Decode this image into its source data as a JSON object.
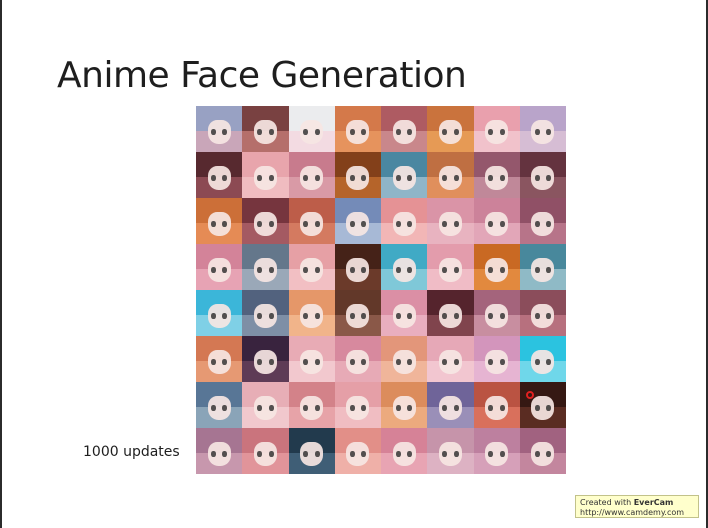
{
  "slide": {
    "title": "Anime Face Generation",
    "caption": "1000 updates"
  },
  "watermark": {
    "prefix": "Created with ",
    "brand": "EverCam",
    "url": "http://www.camdemy.com"
  },
  "grid": {
    "rows": 8,
    "cols": 8,
    "tiles": [
      {
        "bg": "#c9a6b9",
        "hair": "#8fa0c4"
      },
      {
        "bg": "#b56f6b",
        "hair": "#6e3a3a"
      },
      {
        "bg": "#f3dbe2",
        "hair": "#e9eef0"
      },
      {
        "bg": "#e6935d",
        "hair": "#d07447"
      },
      {
        "bg": "#c9878b",
        "hair": "#a9545b"
      },
      {
        "bg": "#e69a55",
        "hair": "#c46c3a"
      },
      {
        "bg": "#f1c2cb",
        "hair": "#e89aa8"
      },
      {
        "bg": "#d6bdd4",
        "hair": "#b4a0c8"
      },
      {
        "bg": "#8c4a53",
        "hair": "#4d2329"
      },
      {
        "bg": "#f0bcc0",
        "hair": "#e6a1a8"
      },
      {
        "bg": "#d99aa6",
        "hair": "#c47588"
      },
      {
        "bg": "#b5642a",
        "hair": "#7a3a17"
      },
      {
        "bg": "#8fb5c8",
        "hair": "#3e7f9a"
      },
      {
        "bg": "#e08f5c",
        "hair": "#b86a3d"
      },
      {
        "bg": "#c08899",
        "hair": "#8c4f64"
      },
      {
        "bg": "#8a5560",
        "hair": "#5d2e39"
      },
      {
        "bg": "#e58b55",
        "hair": "#c86a34"
      },
      {
        "bg": "#a45a62",
        "hair": "#6e2f38"
      },
      {
        "bg": "#d47a60",
        "hair": "#b85845"
      },
      {
        "bg": "#a7b9d6",
        "hair": "#6b83b3"
      },
      {
        "bg": "#f2b6b6",
        "hair": "#e38c8f"
      },
      {
        "bg": "#e8b3c0",
        "hair": "#d78ea2"
      },
      {
        "bg": "#e2a6b8",
        "hair": "#c87b94"
      },
      {
        "bg": "#b77489",
        "hair": "#8a4a60"
      },
      {
        "bg": "#e7a3b4",
        "hair": "#cf7e94"
      },
      {
        "bg": "#9aa8b8",
        "hair": "#5a6f83"
      },
      {
        "bg": "#f2bfc3",
        "hair": "#e49aa0"
      },
      {
        "bg": "#6b3a2a",
        "hair": "#3e1e15"
      },
      {
        "bg": "#7fc8d8",
        "hair": "#35a4c2"
      },
      {
        "bg": "#f0bcc6",
        "hair": "#e196a7"
      },
      {
        "bg": "#e2893e",
        "hair": "#c4641f"
      },
      {
        "bg": "#8fbac6",
        "hair": "#3c7f94"
      },
      {
        "bg": "#7fd0e6",
        "hair": "#2fb2d6"
      },
      {
        "bg": "#7e8fa6",
        "hair": "#4a5b77"
      },
      {
        "bg": "#f1b48a",
        "hair": "#e39263"
      },
      {
        "bg": "#8a5848",
        "hair": "#5a3325"
      },
      {
        "bg": "#e9aebf",
        "hair": "#d88aa0"
      },
      {
        "bg": "#80444d",
        "hair": "#4d1f28"
      },
      {
        "bg": "#c88ea0",
        "hair": "#9e5d75"
      },
      {
        "bg": "#b7707e",
        "hair": "#844755"
      },
      {
        "bg": "#e69973",
        "hair": "#d0724e"
      },
      {
        "bg": "#5e3b56",
        "hair": "#33203a"
      },
      {
        "bg": "#f2c8ce",
        "hair": "#e6a6b0"
      },
      {
        "bg": "#e7aab6",
        "hair": "#d3849a"
      },
      {
        "bg": "#f0b59a",
        "hair": "#e09174"
      },
      {
        "bg": "#f2c6d0",
        "hair": "#e4a2b3"
      },
      {
        "bg": "#e6b4d2",
        "hair": "#cf8fb9"
      },
      {
        "bg": "#6fd7ea",
        "hair": "#20c0de"
      },
      {
        "bg": "#8aa4b8",
        "hair": "#4f6f8f"
      },
      {
        "bg": "#f1c8cd",
        "hair": "#e5a9b1"
      },
      {
        "bg": "#e7a3a8",
        "hair": "#cf7c84"
      },
      {
        "bg": "#f0bdc2",
        "hair": "#e39aa2"
      },
      {
        "bg": "#ecaa7e",
        "hair": "#d98756"
      },
      {
        "bg": "#9a8fb8",
        "hair": "#675d93"
      },
      {
        "bg": "#d9705c",
        "hair": "#b44d3d"
      },
      {
        "bg": "#5a2c22",
        "hair": "#2f1510"
      },
      {
        "bg": "#c797ad",
        "hair": "#a06f8d"
      },
      {
        "bg": "#e1949a",
        "hair": "#c66f78"
      },
      {
        "bg": "#3f5e76",
        "hair": "#1d3447"
      },
      {
        "bg": "#efb0a8",
        "hair": "#df8a82"
      },
      {
        "bg": "#e8a4b3",
        "hair": "#d27d92"
      },
      {
        "bg": "#ddb2c3",
        "hair": "#c28ea6"
      },
      {
        "bg": "#d6a0b9",
        "hair": "#b97a9a"
      },
      {
        "bg": "#c3869e",
        "hair": "#9b5c7a"
      }
    ]
  }
}
